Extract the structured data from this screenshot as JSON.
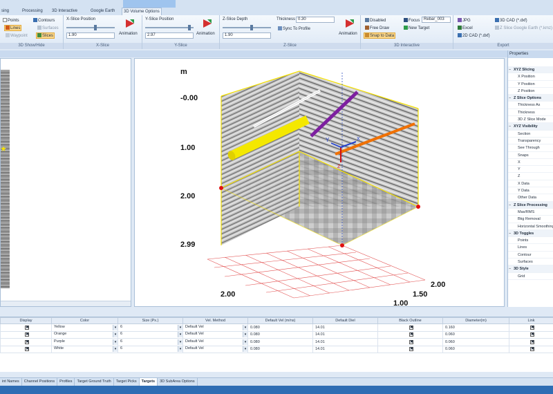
{
  "ribbon_tabs": [
    "sing",
    "Processing",
    "3D Interactive",
    "Google Earth",
    "3D Volume Options"
  ],
  "ribbon": {
    "show_hide": {
      "points": "Points",
      "contours": "Contours",
      "lines": "Lines",
      "surfaces": "Surfaces",
      "waypoint": "Waypoint",
      "slices": "Slices",
      "title": "3D Show/Hide"
    },
    "x_slice": {
      "label": "X-Slice Position",
      "value": "1.90",
      "animation": "Animation",
      "title": "X-Slice"
    },
    "y_slice": {
      "label": "Y-Slice Position",
      "value": "2.97",
      "animation": "Animation",
      "title": "Y-Slice"
    },
    "z_slice": {
      "label": "Z-Slice Depth",
      "value": "1.90",
      "thickness_label": "Thickness",
      "thickness_value": "0.30",
      "sync": "Sync To Profile",
      "animation": "Animation",
      "title": "Z-Slice"
    },
    "interactive": {
      "disabled": "Disabled",
      "free_draw": "Free Draw",
      "snap": "Snap to Data",
      "focus": "Focus",
      "focus_value": "Rebar_003",
      "new_target": "New Target",
      "title": "3D Interactive"
    },
    "export": {
      "jpg": "JPG",
      "excel": "Excel",
      "cad_3d": "3D CAD (*.dxf)",
      "cad_2d": "2D CAD (*.dxf)",
      "google_earth": "Z Slice Google Earth (*.kmz)",
      "title": "Export"
    }
  },
  "view3d": {
    "unit": "m",
    "z_ticks": [
      "-0.00",
      "1.00",
      "2.00",
      "2.99"
    ],
    "x_ticks": [
      "2.00"
    ],
    "y_ticks": [
      "2.00",
      "1.50",
      "1.00"
    ],
    "axis_labels": {
      "y": "Y",
      "x": "X",
      "z": "Z"
    }
  },
  "properties": {
    "title": "Properties",
    "rows": [
      {
        "label": "XYZ Slicing",
        "cat": true
      },
      {
        "label": "X Position"
      },
      {
        "label": "Y Position"
      },
      {
        "label": "Z Position"
      },
      {
        "label": "Z Slice Options",
        "cat": true
      },
      {
        "label": "Thickness As"
      },
      {
        "label": "Thickness"
      },
      {
        "label": "3D Z Slice Mode"
      },
      {
        "label": "XYZ Visibility",
        "cat": true
      },
      {
        "label": "Section"
      },
      {
        "label": "Transparency"
      },
      {
        "label": "See Through"
      },
      {
        "label": "Snaps"
      },
      {
        "label": "X"
      },
      {
        "label": "Y"
      },
      {
        "label": "Z"
      },
      {
        "label": "X Data"
      },
      {
        "label": "Y Data"
      },
      {
        "label": "Other Data"
      },
      {
        "label": "Z Slice Processing",
        "cat": true
      },
      {
        "label": "Max/RMS"
      },
      {
        "label": "Bkg Removal"
      },
      {
        "label": "Horizontal Smoothing"
      },
      {
        "label": "3D Toggles",
        "cat": true
      },
      {
        "label": "Points"
      },
      {
        "label": "Lines"
      },
      {
        "label": "Contour"
      },
      {
        "label": "Surfaces"
      },
      {
        "label": "3D Style",
        "cat": true
      },
      {
        "label": "Grid"
      }
    ]
  },
  "grid": {
    "headers": [
      "Display",
      "Color",
      "Size (Px.)",
      "Vel. Method",
      "Default Vel (m/ns)",
      "Default Diel",
      "Black Outline",
      "Diameter(m)",
      "Link"
    ],
    "rows": [
      {
        "color": "Yellow",
        "size": "6",
        "method": "Default Vel",
        "vel": "0.080",
        "diel": "14.01",
        "diam": "0.160"
      },
      {
        "color": "Orange",
        "size": "6",
        "method": "Default Vel",
        "vel": "0.080",
        "diel": "14.01",
        "diam": "0.060"
      },
      {
        "color": "Purple",
        "size": "6",
        "method": "Default Vel",
        "vel": "0.080",
        "diel": "14.01",
        "diam": "0.060"
      },
      {
        "color": "White",
        "size": "6",
        "method": "Default Vel",
        "vel": "0.080",
        "diel": "14.01",
        "diam": "0.060"
      }
    ],
    "check": "✖"
  },
  "bottom_tabs": [
    "int Names",
    "Channel Positions",
    "Profiles",
    "Target Ground Truth",
    "Target Picks",
    "Targets",
    "3D SubArea Options"
  ],
  "active_bottom_tab": 5
}
